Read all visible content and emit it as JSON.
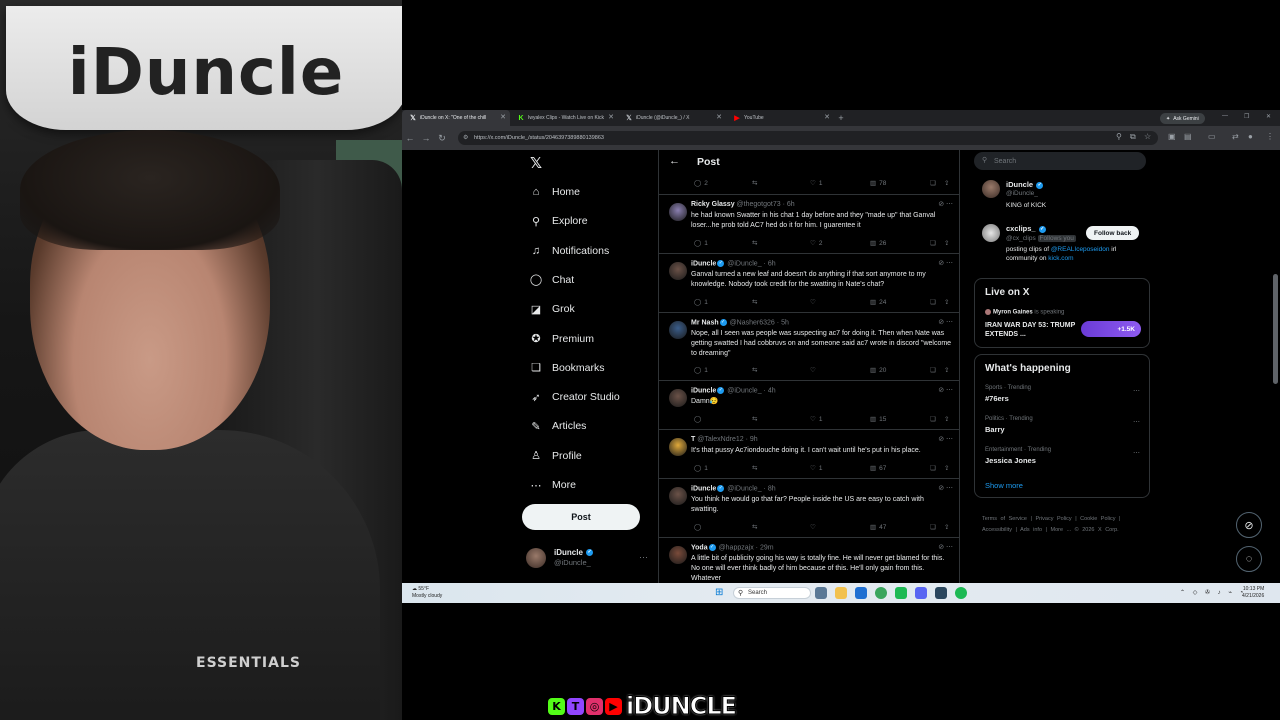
{
  "webcam": {
    "board_text": "iDuncle",
    "shirt_text": "ESSENTIALS"
  },
  "stream_brand": {
    "name": "iDUNCLE",
    "badges": [
      {
        "icon": "kick-icon",
        "glyph": "K",
        "color": "#53fc18"
      },
      {
        "icon": "twitch-icon",
        "glyph": "T",
        "color": "#9146ff"
      },
      {
        "icon": "instagram-icon",
        "glyph": "◎",
        "color": "#e1306c"
      },
      {
        "icon": "youtube-icon",
        "glyph": "▶",
        "color": "#ff0000"
      }
    ]
  },
  "browser": {
    "tabs": [
      {
        "title": "iDuncle on X: \"One of the chill",
        "icon": "x-icon",
        "active": true
      },
      {
        "title": "Iwyalex Clips - Watch Live on Kick",
        "icon": "kick-icon",
        "active": false
      },
      {
        "title": "iDuncle (@iDuncle_) / X",
        "icon": "x-icon",
        "active": false
      },
      {
        "title": "YouTube",
        "icon": "youtube-icon",
        "active": false
      }
    ],
    "ask_gemini": "Ask Gemini",
    "url": "https://x.com/iDuncle_/status/2046397389880139863"
  },
  "xnav": {
    "items": [
      {
        "label": "Home",
        "icon": "home-icon",
        "glyph": "⌂"
      },
      {
        "label": "Explore",
        "icon": "search-icon",
        "glyph": "⚲"
      },
      {
        "label": "Notifications",
        "icon": "bell-icon",
        "glyph": "♫"
      },
      {
        "label": "Chat",
        "icon": "chat-icon",
        "glyph": "◯"
      },
      {
        "label": "Grok",
        "icon": "grok-icon",
        "glyph": "◪"
      },
      {
        "label": "Premium",
        "icon": "premium-icon",
        "glyph": "✪"
      },
      {
        "label": "Bookmarks",
        "icon": "bookmark-icon",
        "glyph": "❏"
      },
      {
        "label": "Creator Studio",
        "icon": "rocket-icon",
        "glyph": "➶"
      },
      {
        "label": "Articles",
        "icon": "article-icon",
        "glyph": "✎"
      },
      {
        "label": "Profile",
        "icon": "profile-icon",
        "glyph": "♙"
      },
      {
        "label": "More",
        "icon": "more-icon",
        "glyph": "⋯"
      }
    ],
    "post_button": "Post",
    "me": {
      "name": "iDuncle",
      "handle": "@iDuncle_"
    }
  },
  "post_header": {
    "title": "Post"
  },
  "tweets": [
    {
      "name": "",
      "handle": "",
      "time": "",
      "text": "",
      "replies": "2",
      "likes": "1",
      "views": "78",
      "avatar_color": "#333"
    },
    {
      "name": "Ricky Glassy",
      "handle": "@thegotgot73",
      "time": "6h",
      "verified": false,
      "text": "he had known Swatter in his chat 1 day before and they \"made up\" that Ganval loser...he prob told AC7 hed do it for him. I guarentee it",
      "replies": "1",
      "likes": "2",
      "views": "26",
      "avatar_color": "#8a7fb0"
    },
    {
      "name": "iDuncle",
      "handle": "@iDuncle_",
      "time": "6h",
      "verified": true,
      "text": "Ganval turned a new leaf and doesn't do anything if that sort anymore to my knowledge. Nobody took credit for the swatting in Nate's chat?",
      "replies": "1",
      "likes": "",
      "views": "24",
      "avatar_color": "#6b5248"
    },
    {
      "name": "Mr Nash",
      "handle": "@Nasher6326",
      "time": "5h",
      "verified": true,
      "text": "Nope, all I seen was people was suspecting ac7 for doing it. Then when Nate was getting swatted I had cobbruvs on and someone said ac7 wrote in discord \"welcome to dreaming\"",
      "replies": "1",
      "likes": "",
      "views": "20",
      "avatar_color": "#3a5d8a"
    },
    {
      "name": "iDuncle",
      "handle": "@iDuncle_",
      "time": "4h",
      "verified": true,
      "text": "Damn😥",
      "replies": "",
      "likes": "1",
      "views": "15",
      "avatar_color": "#6b5248"
    },
    {
      "name": "T",
      "handle": "@TalexNdre12",
      "time": "9h",
      "verified": false,
      "text": "It's that pussy Ac7iondouche doing it. I can't wait until he's put in his place.",
      "replies": "1",
      "likes": "1",
      "views": "67",
      "avatar_color": "#e0a93a"
    },
    {
      "name": "iDuncle",
      "handle": "@iDuncle_",
      "time": "8h",
      "verified": true,
      "text": "You think he would go that far? People inside the US are easy to catch with swatting.",
      "replies": "",
      "likes": "",
      "views": "47",
      "avatar_color": "#6b5248"
    },
    {
      "name": "Yoda",
      "handle": "@happzajx",
      "time": "29m",
      "verified": true,
      "text": "A little bit of publicity going his way is totally fine. He will never get blamed for this. No one will ever think badly of him because of this. He'll only gain from this. Whatever",
      "replies": "",
      "likes": "",
      "views": "",
      "avatar_color": "#7a4b3a"
    }
  ],
  "right": {
    "search_placeholder": "Search",
    "accounts": [
      {
        "name": "iDuncle",
        "handle": "@iDuncle_",
        "bio": "KING of KICK",
        "follow": ""
      },
      {
        "name": "cxclips_",
        "handle": "@cx_clips",
        "follows_you": "Follows you",
        "bio_a": "posting clips of ",
        "bio_link": "@REALIceposeidon",
        "bio_b": " irl community on ",
        "bio_link2": "kick.com",
        "follow": "Follow back"
      }
    ],
    "live": {
      "title": "Live on X",
      "host": "Myron Gaines",
      "host_status": "is speaking",
      "topic": "IRAN WAR DAY 53: TRUMP EXTENDS ...",
      "count": "+1.5K"
    },
    "happening": {
      "title": "What's happening",
      "trends": [
        {
          "category": "Sports · Trending",
          "name": "#76ers"
        },
        {
          "category": "Politics · Trending",
          "name": "Barry"
        },
        {
          "category": "Entertainment · Trending",
          "name": "Jessica Jones"
        }
      ],
      "show_more": "Show more"
    },
    "footer": "Terms of Service | Privacy Policy | Cookie Policy | Accessibility | Ads info | More ... © 2026 X Corp."
  },
  "taskbar": {
    "weather_temp": "55°F",
    "weather_desc": "Mostly cloudy",
    "search": "Search",
    "time": "10:13 PM",
    "date": "4/21/2026"
  }
}
